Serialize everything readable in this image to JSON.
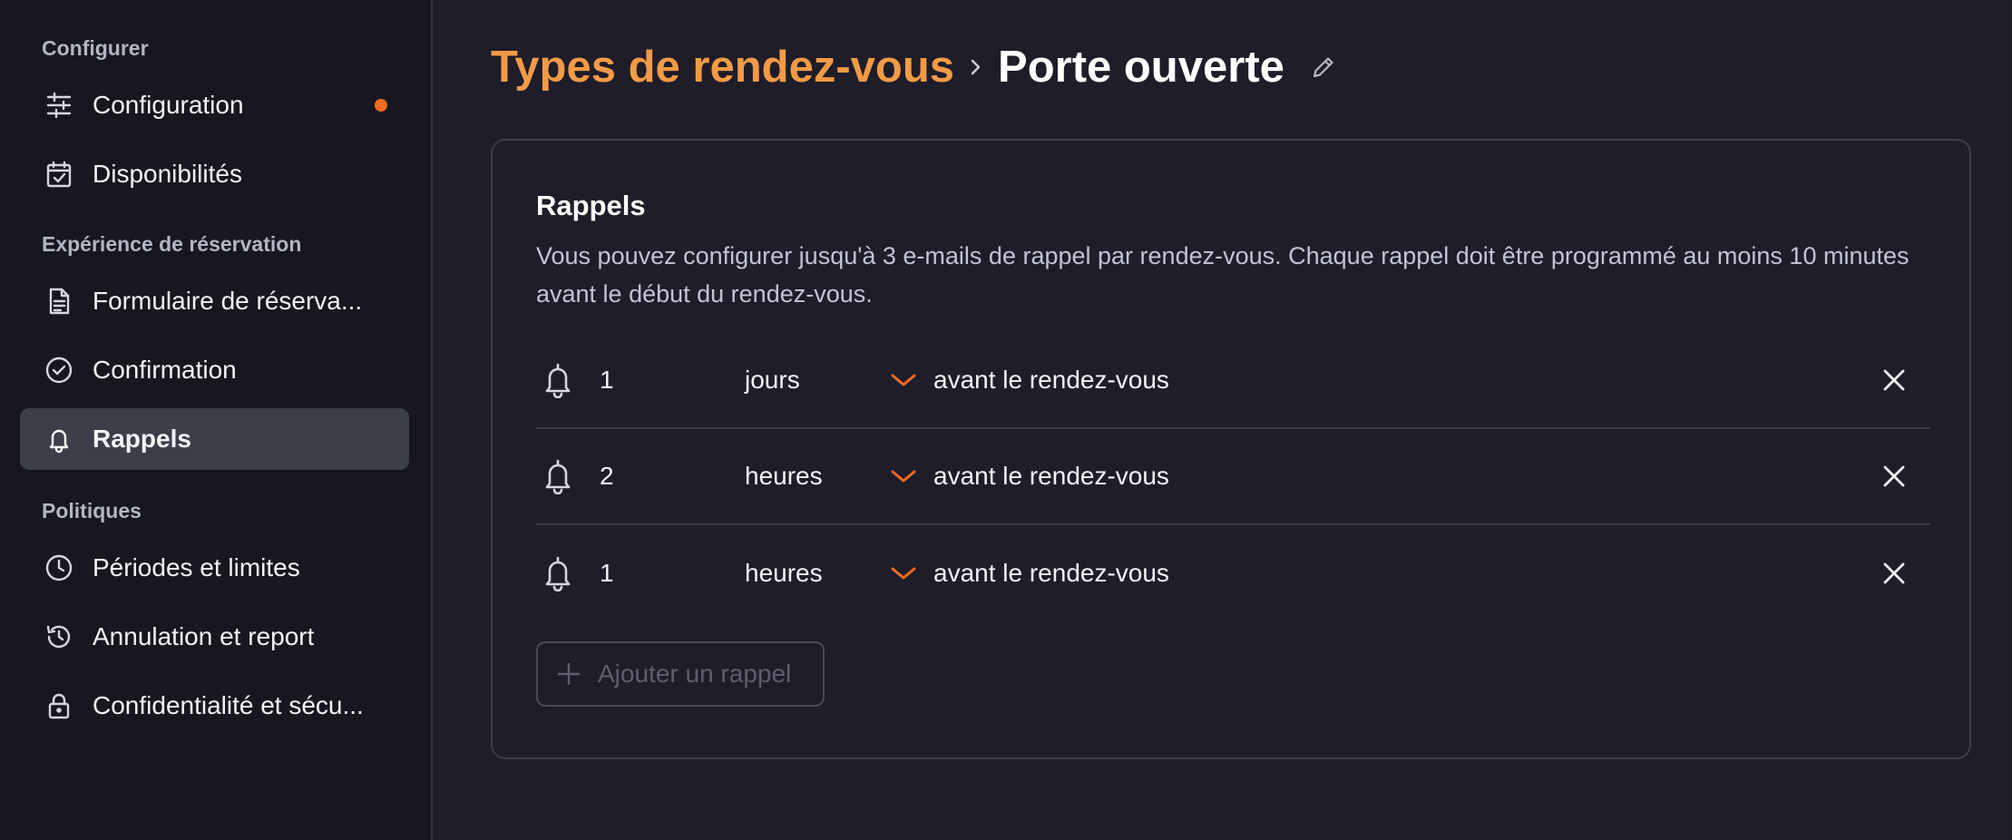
{
  "sidebar": {
    "sections": [
      {
        "title": "Configurer",
        "items": [
          {
            "label": "Configuration",
            "icon": "sliders-icon",
            "badge": true
          },
          {
            "label": "Disponibilités",
            "icon": "calendar-check-icon"
          }
        ]
      },
      {
        "title": "Expérience de réservation",
        "items": [
          {
            "label": "Formulaire de réserva...",
            "icon": "document-icon"
          },
          {
            "label": "Confirmation",
            "icon": "check-circle-icon"
          },
          {
            "label": "Rappels",
            "icon": "bell-icon",
            "active": true
          }
        ]
      },
      {
        "title": "Politiques",
        "items": [
          {
            "label": "Périodes et limites",
            "icon": "clock-icon"
          },
          {
            "label": "Annulation et report",
            "icon": "history-icon"
          },
          {
            "label": "Confidentialité et sécu...",
            "icon": "lock-icon"
          }
        ]
      }
    ]
  },
  "header": {
    "breadcrumb": "Types de rendez-vous",
    "title": "Porte ouverte"
  },
  "card": {
    "title": "Rappels",
    "description": "Vous pouvez configurer jusqu'à 3 e-mails de rappel par rendez-vous. Chaque rappel doit être programmé au moins 10 minutes avant le début du rendez-vous.",
    "reminders": [
      {
        "value": "1",
        "unit": "jours",
        "when": "avant le rendez-vous"
      },
      {
        "value": "2",
        "unit": "heures",
        "when": "avant le rendez-vous"
      },
      {
        "value": "1",
        "unit": "heures",
        "when": "avant le rendez-vous"
      }
    ],
    "add_label": "Ajouter un rappel"
  },
  "colors": {
    "accent": "#f29a46",
    "chevron": "#f26b21",
    "background": "#1e1d29",
    "sidebar": "#171720"
  }
}
